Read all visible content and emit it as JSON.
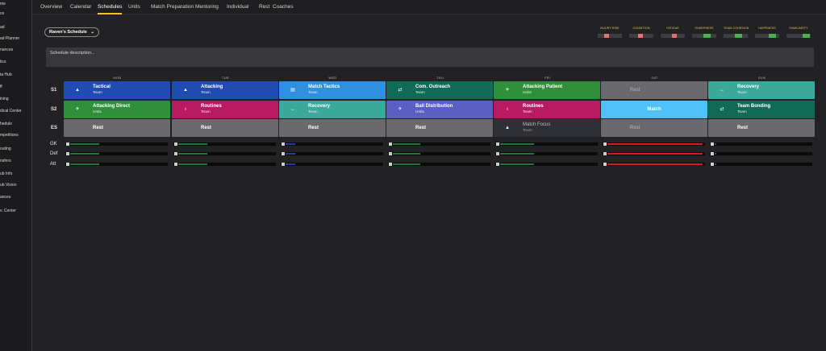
{
  "sidebar": {
    "items": [
      "me",
      "ox",
      "ad",
      "ad Planner",
      "nances",
      "tics",
      "ta Hub",
      "ff",
      "ining",
      "dical Center",
      "hedule",
      "mpetitions",
      "outing",
      "nsfers",
      "ub Info",
      "ub Vision",
      "ances",
      "v. Center"
    ]
  },
  "nav": {
    "tabs": [
      "Overview",
      "Calendar",
      "Schedules",
      "Units",
      "Match Preparation",
      "Mentoring",
      "Individual",
      "Rest",
      "Coaches"
    ],
    "active": "Schedules"
  },
  "schedule_selector": {
    "label": "Raven's Schedule",
    "chevron_icon": "chevron-down-icon"
  },
  "metrics": [
    {
      "label": "INJURY RISK",
      "color": "#e57373",
      "level": 0.35
    },
    {
      "label": "CONDITION",
      "color": "#e57373",
      "level": 0.45
    },
    {
      "label": "FATIGUE",
      "color": "#e57373",
      "level": 0.55
    },
    {
      "label": "SHARPNESS",
      "color": "#4caf50",
      "level": 0.55
    },
    {
      "label": "TEAM COHESION",
      "color": "#4caf50",
      "level": 0.55
    },
    {
      "label": "HAPPINESS",
      "color": "#4caf50",
      "level": 0.65
    },
    {
      "label": "FAMILIARITY",
      "color": "#4caf50",
      "level": 0.75
    }
  ],
  "description_placeholder": "Schedule description...",
  "days": [
    "MON",
    "TUE",
    "WED",
    "THU",
    "FRI",
    "SAT",
    "SUN"
  ],
  "session_rows": [
    {
      "label": "S1",
      "cells": [
        {
          "title": "Tactical",
          "sub": "Team",
          "color": "#1f4bb3",
          "icon": "cone-icon",
          "glyph": "▲"
        },
        {
          "title": "Attacking",
          "sub": "Team",
          "color": "#1f4bb3",
          "icon": "cone-icon",
          "glyph": "▲"
        },
        {
          "title": "Match Tactics",
          "sub": "Team",
          "color": "#2f8fe0",
          "icon": "clipboard-icon",
          "glyph": "▤"
        },
        {
          "title": "Com. Outreach",
          "sub": "Team",
          "color": "#0f6b55",
          "icon": "handshake-icon",
          "glyph": "⇄"
        },
        {
          "title": "Attacking Patient",
          "sub": "Units",
          "color": "#2f8f3a",
          "icon": "runner-icon",
          "glyph": "✈"
        },
        {
          "title": "Rest",
          "sub": "",
          "color": "#6a6a6c",
          "icon": "",
          "glyph": "",
          "dim": true
        },
        {
          "title": "Recovery",
          "sub": "Team",
          "color": "#3aa89a",
          "icon": "dumbbell-icon",
          "glyph": "↔"
        }
      ]
    },
    {
      "label": "S2",
      "cells": [
        {
          "title": "Attacking Direct",
          "sub": "Units",
          "color": "#2f8f3a",
          "icon": "runner-icon",
          "glyph": "✈"
        },
        {
          "title": "Routines",
          "sub": "Team",
          "color": "#b81b63",
          "icon": "whistle-icon",
          "glyph": "♁"
        },
        {
          "title": "Recovery",
          "sub": "Team",
          "color": "#3aa89a",
          "icon": "dumbbell-icon",
          "glyph": "↔"
        },
        {
          "title": "Ball Distribution",
          "sub": "Units",
          "color": "#5a5fc2",
          "icon": "runner-icon",
          "glyph": "✈"
        },
        {
          "title": "Routines",
          "sub": "Team",
          "color": "#b81b63",
          "icon": "whistle-icon",
          "glyph": "♁"
        },
        {
          "title": "Match",
          "sub": "",
          "color": "#4fc3f7",
          "icon": "",
          "glyph": "",
          "center": true
        },
        {
          "title": "Team Bonding",
          "sub": "Team",
          "color": "#0f6b55",
          "icon": "handshake-icon",
          "glyph": "⇄"
        }
      ]
    },
    {
      "label": "ES",
      "cells": [
        {
          "title": "Rest",
          "sub": "",
          "color": "#6a6a6c",
          "icon": "",
          "glyph": ""
        },
        {
          "title": "Rest",
          "sub": "",
          "color": "#6a6a6c",
          "icon": "",
          "glyph": ""
        },
        {
          "title": "Rest",
          "sub": "",
          "color": "#6a6a6c",
          "icon": "",
          "glyph": ""
        },
        {
          "title": "Rest",
          "sub": "",
          "color": "#6a6a6c",
          "icon": "",
          "glyph": ""
        },
        {
          "title": "Match Focus",
          "sub": "Team",
          "color": "#2f3035",
          "icon": "cone-icon",
          "glyph": "▲",
          "muted": true
        },
        {
          "title": "Rest",
          "sub": "",
          "color": "#6a6a6c",
          "icon": "",
          "glyph": "",
          "dim": true
        },
        {
          "title": "Rest",
          "sub": "",
          "color": "#6a6a6c",
          "icon": "",
          "glyph": ""
        }
      ]
    }
  ],
  "load_rows": [
    {
      "label": "GK",
      "values": [
        {
          "level": 0.3,
          "color": "#1b7a3a"
        },
        {
          "level": 0.3,
          "color": "#1b7a3a"
        },
        {
          "level": 0.1,
          "color": "#1f3e9e"
        },
        {
          "level": 0.28,
          "color": "#1b7a3a"
        },
        {
          "level": 0.35,
          "color": "#1b7a3a"
        },
        {
          "level": 0.98,
          "color": "#d81b1b"
        },
        {
          "level": 0.02,
          "color": "#1f3e9e"
        }
      ]
    },
    {
      "label": "Def",
      "values": [
        {
          "level": 0.3,
          "color": "#1b7a3a"
        },
        {
          "level": 0.3,
          "color": "#1b7a3a"
        },
        {
          "level": 0.1,
          "color": "#1f3e9e"
        },
        {
          "level": 0.28,
          "color": "#1b7a3a"
        },
        {
          "level": 0.35,
          "color": "#1b7a3a"
        },
        {
          "level": 0.98,
          "color": "#d81b1b"
        },
        {
          "level": 0.02,
          "color": "#1f3e9e"
        }
      ]
    },
    {
      "label": "Att",
      "values": [
        {
          "level": 0.3,
          "color": "#1b7a3a"
        },
        {
          "level": 0.3,
          "color": "#1b7a3a"
        },
        {
          "level": 0.1,
          "color": "#1f3e9e"
        },
        {
          "level": 0.28,
          "color": "#1b7a3a"
        },
        {
          "level": 0.35,
          "color": "#1b7a3a"
        },
        {
          "level": 0.98,
          "color": "#d81b1b"
        },
        {
          "level": 0.02,
          "color": "#1f3e9e"
        }
      ]
    }
  ]
}
